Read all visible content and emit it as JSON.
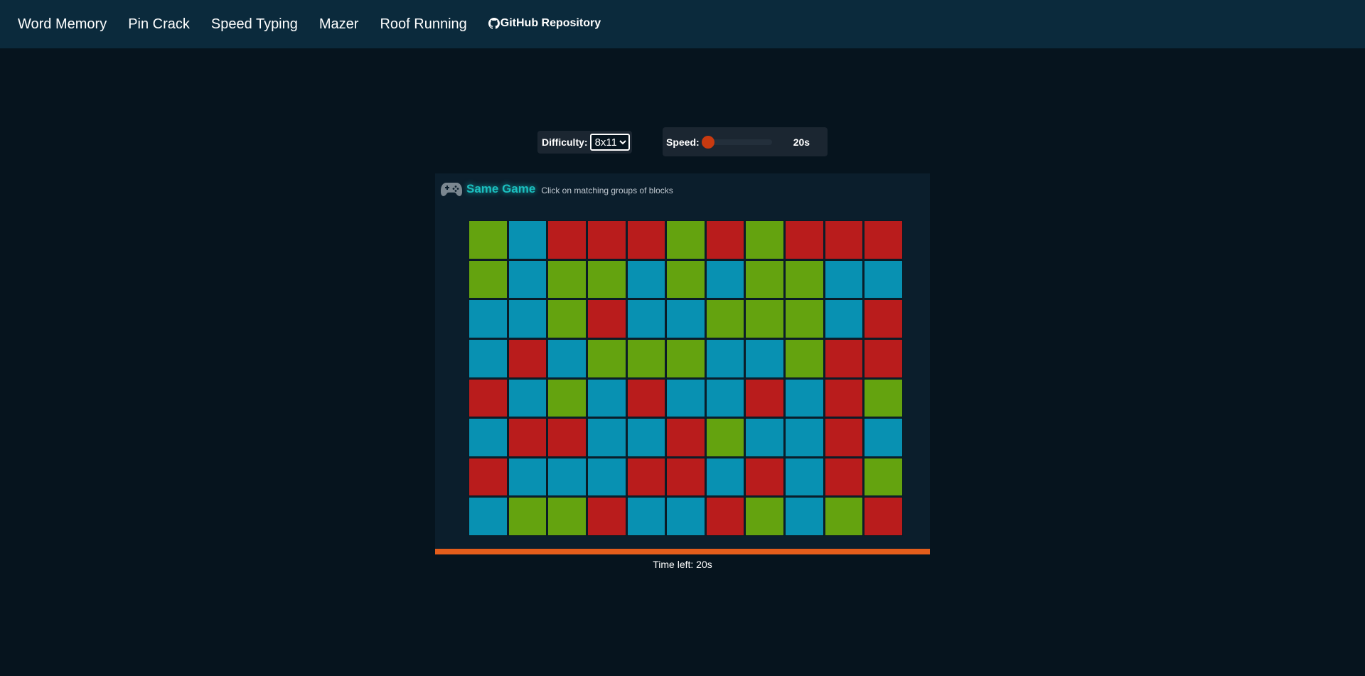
{
  "nav": {
    "links": [
      "Word Memory",
      "Pin Crack",
      "Speed Typing",
      "Mazer",
      "Roof Running"
    ],
    "github_label": "GitHub Repository",
    "github_icon": "github-icon"
  },
  "controls": {
    "difficulty_label": "Difficulty:",
    "difficulty_value": "8x11",
    "speed_label": "Speed:",
    "speed_value": "20s",
    "speed_slider_fraction": 0.0
  },
  "game": {
    "icon": "gamepad-icon",
    "title": "Same Game",
    "subtitle": "Click on matching groups of blocks",
    "rows": 8,
    "cols": 11,
    "colors": {
      "G": "#64a30f",
      "B": "#0891b2",
      "R": "#b91c1c"
    },
    "board": [
      [
        "G",
        "B",
        "R",
        "R",
        "R",
        "G",
        "R",
        "G",
        "R",
        "R",
        "R"
      ],
      [
        "G",
        "B",
        "G",
        "G",
        "B",
        "G",
        "B",
        "G",
        "G",
        "B",
        "B"
      ],
      [
        "B",
        "B",
        "G",
        "R",
        "B",
        "B",
        "G",
        "G",
        "G",
        "B",
        "R"
      ],
      [
        "B",
        "R",
        "B",
        "G",
        "G",
        "G",
        "B",
        "B",
        "G",
        "R",
        "R"
      ],
      [
        "R",
        "B",
        "G",
        "B",
        "R",
        "B",
        "B",
        "R",
        "B",
        "R",
        "G"
      ],
      [
        "B",
        "R",
        "R",
        "B",
        "B",
        "R",
        "G",
        "B",
        "B",
        "R",
        "B"
      ],
      [
        "R",
        "B",
        "B",
        "B",
        "R",
        "R",
        "B",
        "R",
        "B",
        "R",
        "G"
      ],
      [
        "B",
        "G",
        "G",
        "R",
        "B",
        "B",
        "R",
        "G",
        "B",
        "G",
        "R"
      ]
    ]
  },
  "timer": {
    "fraction_remaining": 1.0,
    "bar_color": "#e35d1b",
    "label": "Time left: 20s"
  }
}
